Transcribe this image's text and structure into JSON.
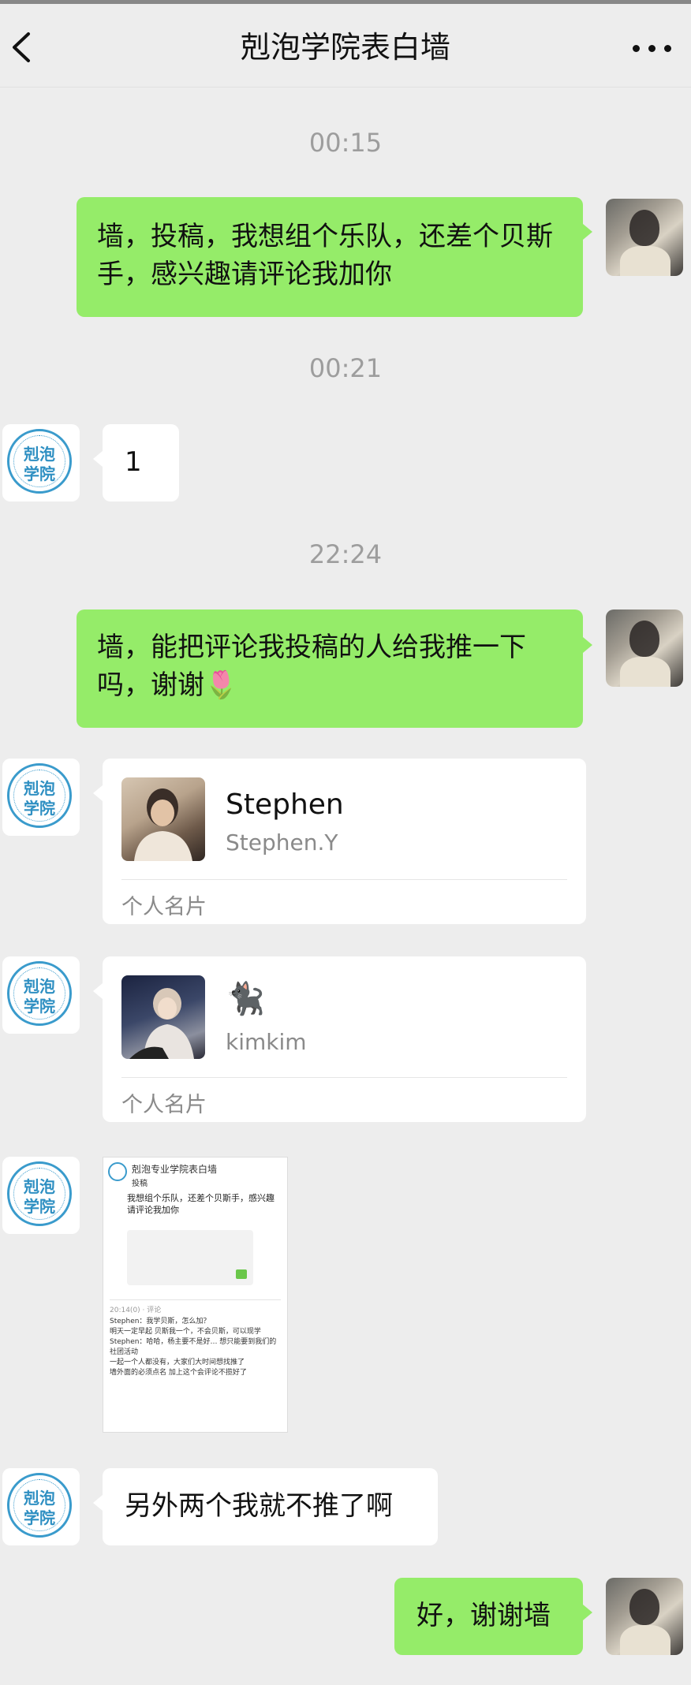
{
  "header": {
    "title": "剋泡学院表白墙"
  },
  "seal": {
    "line1": "剋泡",
    "line2": "学院"
  },
  "messages": {
    "t1": "00:15",
    "m1": "墙，投稿，我想组个乐队，还差个贝斯手，感兴趣请评论我加你",
    "t2": "00:21",
    "m2": "1",
    "t3": "22:24",
    "m3": "墙，能把评论我投稿的人给我推一下吗，谢谢🌷",
    "card1": {
      "name": "Stephen",
      "id": "Stephen.Y",
      "type": "个人名片"
    },
    "card2": {
      "name": "🐈‍⬛",
      "id": "kimkim",
      "type": "个人名片"
    },
    "shot": {
      "title": "剋泡专业学院表白墙",
      "sub": "投稿",
      "body": "我想组个乐队，还差个贝斯手，感兴趣请评论我加你",
      "meta": "20:14(0)  · 评论",
      "comments": "Stephen：我学贝斯，怎么加？\n明天一定早起 贝斯我一个，不会贝斯，可以现学\nStephen：哈哈，杨主要不是好… 想只能要到我们的社团活动\n一起一个人都没有，大家们大时间想找推了\n墙外面的必须点名 加上这个会评论不揽好了"
    },
    "m4": "另外两个我就不推了啊",
    "m5": "好，谢谢墙"
  }
}
